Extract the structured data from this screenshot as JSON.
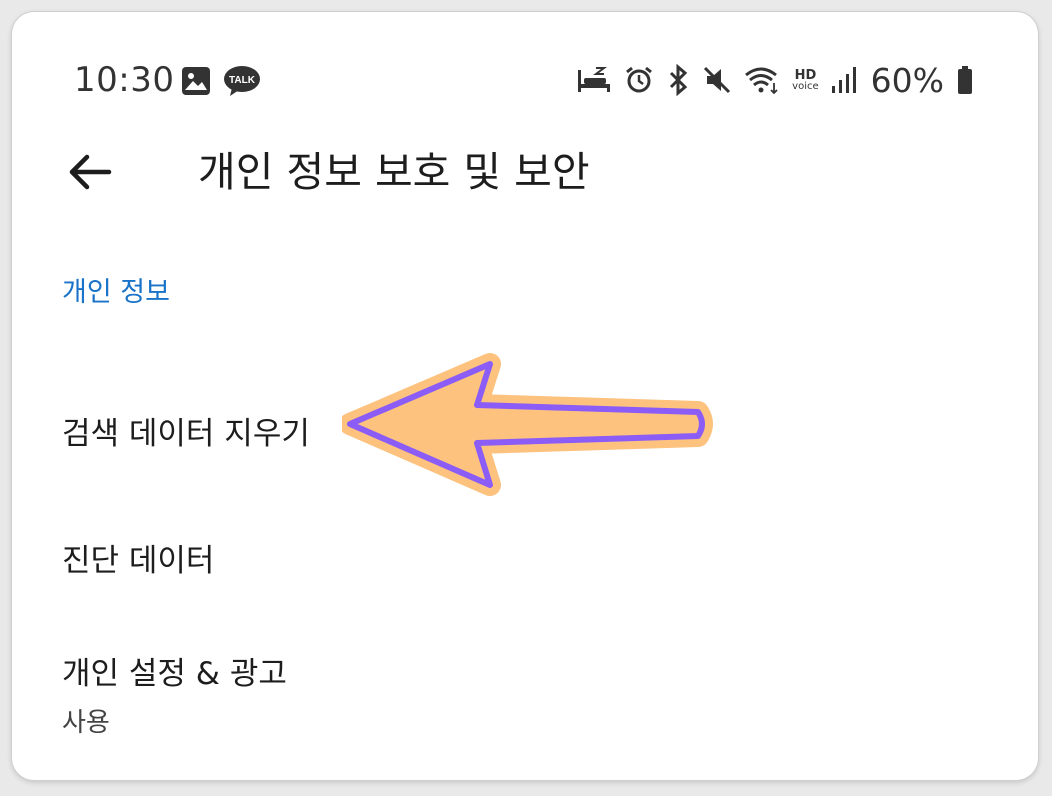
{
  "status_bar": {
    "time": "10:30",
    "battery_percent": "60%",
    "hd_label": "HD",
    "voice_label": "voice",
    "talk_label": "TALK",
    "left_icons": [
      "gallery-icon",
      "kakaotalk-icon"
    ],
    "right_icons": [
      "sleep-icon",
      "alarm-icon",
      "bluetooth-icon",
      "mute-icon",
      "wifi-icon",
      "hd-voice-icon",
      "signal-icon",
      "battery-icon"
    ]
  },
  "app_bar": {
    "back_icon": "arrow-left-icon",
    "title": "개인 정보 보호 및 보안"
  },
  "section": {
    "header": "개인 정보"
  },
  "items": [
    {
      "title": "검색 데이터 지우기"
    },
    {
      "title": "진단 데이터"
    },
    {
      "title": "개인 설정 & 광고",
      "subtitle": "사용"
    }
  ],
  "colors": {
    "accent": "#1a73c8",
    "arrow_fill": "#fcc27e",
    "arrow_outline": "#8b5cf6"
  }
}
